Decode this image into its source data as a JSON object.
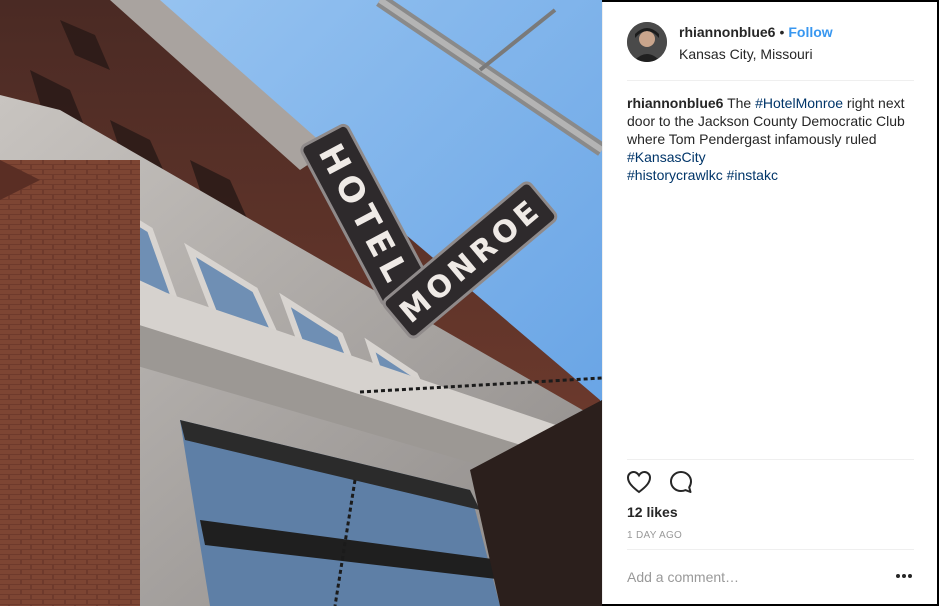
{
  "post": {
    "username": "rhiannonblue6",
    "separator": "•",
    "follow_label": "Follow",
    "location": "Kansas City, Missouri",
    "caption": {
      "username": "rhiannonblue6",
      "text_1": " The ",
      "tag_1": "#HotelMonroe",
      "text_2": " right next door to the Jackson County Democratic Club where Tom Pendergast infamously ruled ",
      "tag_2": "#KansasCity",
      "tag_3": "#historycrawlkc",
      "tag_4": "#instakc"
    },
    "likes": "12 likes",
    "time": "1 DAY AGO",
    "comment_placeholder": "Add a comment…"
  },
  "photo": {
    "sign_word_1": "HOTEL",
    "sign_word_2": "MONROE"
  },
  "icons": {
    "like": "heart-icon",
    "comment": "speech-bubble-icon",
    "more": "more-options-icon"
  },
  "colors": {
    "follow": "#3897f0",
    "hashtag": "#003569",
    "sky": "#7fb2ec",
    "brick": "#6b3a2c"
  }
}
